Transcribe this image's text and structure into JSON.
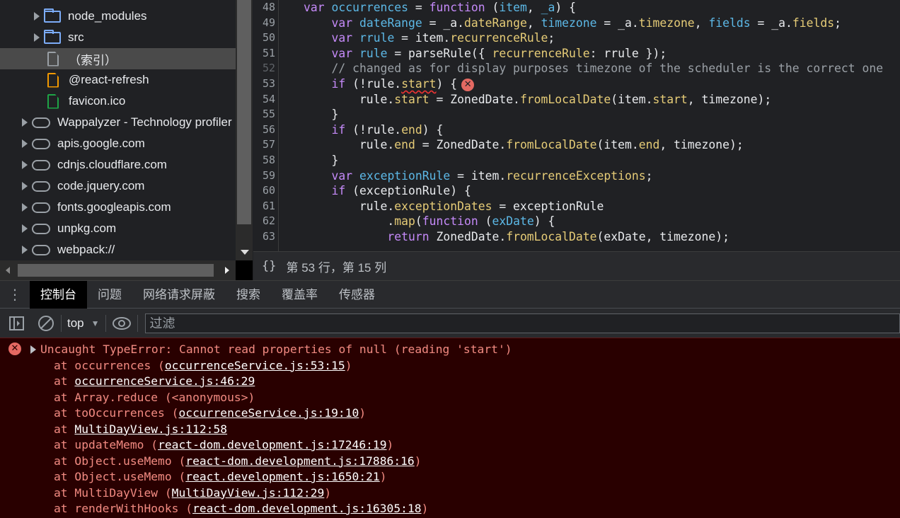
{
  "navigator": {
    "items": [
      {
        "label": "node_modules",
        "type": "folder",
        "indent": 1
      },
      {
        "label": "src",
        "type": "folder",
        "indent": 1
      },
      {
        "label": "（索引）",
        "type": "file",
        "color": "#9aa0a6",
        "indent": 1,
        "selected": true
      },
      {
        "label": "@react-refresh",
        "type": "file",
        "color": "#f29900",
        "indent": 1
      },
      {
        "label": "favicon.ico",
        "type": "file",
        "color": "#1ea446",
        "indent": 1
      },
      {
        "label": "Wappalyzer - Technology profiler",
        "type": "cloud",
        "indent": 0
      },
      {
        "label": "apis.google.com",
        "type": "cloud",
        "indent": 0
      },
      {
        "label": "cdnjs.cloudflare.com",
        "type": "cloud",
        "indent": 0
      },
      {
        "label": "code.jquery.com",
        "type": "cloud",
        "indent": 0
      },
      {
        "label": "fonts.googleapis.com",
        "type": "cloud",
        "indent": 0
      },
      {
        "label": "unpkg.com",
        "type": "cloud",
        "indent": 0
      },
      {
        "label": "webpack://",
        "type": "cloud",
        "indent": 0
      }
    ]
  },
  "editor": {
    "error_line": 53,
    "lines": [
      {
        "n": "48",
        "tokens": [
          [
            "var",
            "k"
          ],
          [
            " ",
            "t"
          ],
          [
            "occurrences",
            "d"
          ],
          [
            " = ",
            "t"
          ],
          [
            "function",
            "k"
          ],
          [
            " (",
            "t"
          ],
          [
            "item",
            "d"
          ],
          [
            ", ",
            "t"
          ],
          [
            "_a",
            "d"
          ],
          [
            ") {",
            "t"
          ]
        ]
      },
      {
        "n": "49",
        "tokens": [
          [
            "    ",
            "t"
          ],
          [
            "var",
            "k"
          ],
          [
            " ",
            "t"
          ],
          [
            "dateRange",
            "d"
          ],
          [
            " = _a.",
            "t"
          ],
          [
            "dateRange",
            "p"
          ],
          [
            ", ",
            "t"
          ],
          [
            "timezone",
            "d"
          ],
          [
            " = _a.",
            "t"
          ],
          [
            "timezone",
            "p"
          ],
          [
            ", ",
            "t"
          ],
          [
            "fields",
            "d"
          ],
          [
            " = _a.",
            "t"
          ],
          [
            "fields",
            "p"
          ],
          [
            ";",
            "t"
          ]
        ]
      },
      {
        "n": "50",
        "tokens": [
          [
            "    ",
            "t"
          ],
          [
            "var",
            "k"
          ],
          [
            " ",
            "t"
          ],
          [
            "rrule",
            "d"
          ],
          [
            " = item.",
            "t"
          ],
          [
            "recurrenceRule",
            "p"
          ],
          [
            ";",
            "t"
          ]
        ]
      },
      {
        "n": "51",
        "tokens": [
          [
            "    ",
            "t"
          ],
          [
            "var",
            "k"
          ],
          [
            " ",
            "t"
          ],
          [
            "rule",
            "d"
          ],
          [
            " = parseRule({ ",
            "t"
          ],
          [
            "recurrenceRule",
            "p"
          ],
          [
            ": rrule });",
            "t"
          ]
        ]
      },
      {
        "n": "52",
        "tokens": [
          [
            "    ",
            "t"
          ],
          [
            "// changed as for display purposes timezone of the scheduler is the correct one",
            "c"
          ]
        ]
      },
      {
        "n": "53",
        "tokens": [
          [
            "    ",
            "t"
          ],
          [
            "if",
            "k"
          ],
          [
            " (!rule.",
            "t"
          ],
          [
            "start",
            "p err"
          ],
          [
            ") {",
            "t"
          ]
        ],
        "error": "✕"
      },
      {
        "n": "54",
        "tokens": [
          [
            "        rule.",
            "t"
          ],
          [
            "start",
            "p"
          ],
          [
            " = ZonedDate.",
            "t"
          ],
          [
            "fromLocalDate",
            "p"
          ],
          [
            "(item.",
            "t"
          ],
          [
            "start",
            "p"
          ],
          [
            ", timezone);",
            "t"
          ]
        ]
      },
      {
        "n": "55",
        "tokens": [
          [
            "    }",
            "t"
          ]
        ]
      },
      {
        "n": "56",
        "tokens": [
          [
            "    ",
            "t"
          ],
          [
            "if",
            "k"
          ],
          [
            " (!rule.",
            "t"
          ],
          [
            "end",
            "p"
          ],
          [
            ") {",
            "t"
          ]
        ]
      },
      {
        "n": "57",
        "tokens": [
          [
            "        rule.",
            "t"
          ],
          [
            "end",
            "p"
          ],
          [
            " = ZonedDate.",
            "t"
          ],
          [
            "fromLocalDate",
            "p"
          ],
          [
            "(item.",
            "t"
          ],
          [
            "end",
            "p"
          ],
          [
            ", timezone);",
            "t"
          ]
        ]
      },
      {
        "n": "58",
        "tokens": [
          [
            "    }",
            "t"
          ]
        ]
      },
      {
        "n": "59",
        "tokens": [
          [
            "    ",
            "t"
          ],
          [
            "var",
            "k"
          ],
          [
            " ",
            "t"
          ],
          [
            "exceptionRule",
            "d"
          ],
          [
            " = item.",
            "t"
          ],
          [
            "recurrenceExceptions",
            "p"
          ],
          [
            ";",
            "t"
          ]
        ]
      },
      {
        "n": "60",
        "tokens": [
          [
            "    ",
            "t"
          ],
          [
            "if",
            "k"
          ],
          [
            " (exceptionRule) {",
            "t"
          ]
        ]
      },
      {
        "n": "61",
        "tokens": [
          [
            "        rule.",
            "t"
          ],
          [
            "exceptionDates",
            "p"
          ],
          [
            " = exceptionRule",
            "t"
          ]
        ]
      },
      {
        "n": "62",
        "tokens": [
          [
            "            .",
            "t"
          ],
          [
            "map",
            "p"
          ],
          [
            "(",
            "t"
          ],
          [
            "function",
            "k"
          ],
          [
            " (",
            "t"
          ],
          [
            "exDate",
            "d"
          ],
          [
            ") {",
            "t"
          ]
        ]
      },
      {
        "n": "63",
        "tokens": [
          [
            "            ",
            "t"
          ],
          [
            "return",
            "k"
          ],
          [
            " ZonedDate.",
            "t"
          ],
          [
            "fromLocalDate",
            "p"
          ],
          [
            "(exDate, timezone);",
            "t"
          ]
        ]
      }
    ]
  },
  "status": {
    "position": "第 53 行，第 15 列"
  },
  "drawer": {
    "tabs": [
      "控制台",
      "问题",
      "网络请求屏蔽",
      "搜索",
      "覆盖率",
      "传感器"
    ],
    "active_tab": 0,
    "context": "top",
    "filter_placeholder": "过滤"
  },
  "console": {
    "message": "Uncaught TypeError: Cannot read properties of null (reading 'start')",
    "stack": [
      {
        "fn": "occurrences",
        "loc": "occurrenceService.js:53:15"
      },
      {
        "fn": "",
        "loc": "occurrenceService.js:46:29"
      },
      {
        "fn": "Array.reduce",
        "loc": "<anonymous>",
        "plain": true
      },
      {
        "fn": "toOccurrences",
        "loc": "occurrenceService.js:19:10"
      },
      {
        "fn": "",
        "loc": "MultiDayView.js:112:58"
      },
      {
        "fn": "updateMemo",
        "loc": "react-dom.development.js:17246:19"
      },
      {
        "fn": "Object.useMemo",
        "loc": "react-dom.development.js:17886:16"
      },
      {
        "fn": "Object.useMemo",
        "loc": "react.development.js:1650:21"
      },
      {
        "fn": "MultiDayView",
        "loc": "MultiDayView.js:112:29"
      },
      {
        "fn": "renderWithHooks",
        "loc": "react-dom.development.js:16305:18"
      }
    ]
  }
}
